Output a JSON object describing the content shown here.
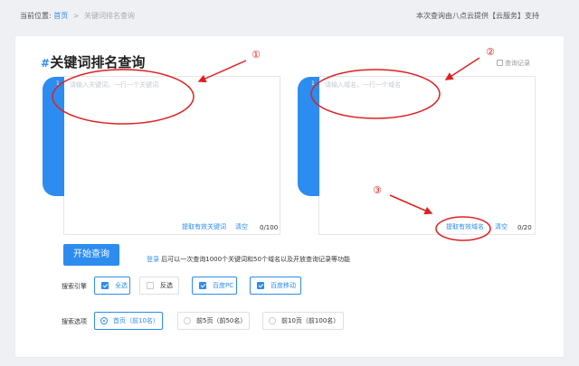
{
  "breadcrumb": {
    "prefix": "当前位置:",
    "home": "首页",
    "separator": ">",
    "current": "关键词排名查询"
  },
  "provider": "本次查询由八点云提供【云服务】支持",
  "page": {
    "title": "关键词排名查询",
    "history": "查询记录"
  },
  "keywords": {
    "line": "1",
    "placeholder": "请输入关键词，一行一个关键词",
    "extract": "提取有效关键词",
    "clear": "清空",
    "count": "0/100"
  },
  "domains": {
    "line": "1",
    "placeholder": "请输入域名，一行一个域名",
    "extract": "提取有效域名",
    "clear": "清空",
    "count": "0/20"
  },
  "annotations": [
    "①",
    "②",
    "③"
  ],
  "start_button": "开始查询",
  "login_tip": {
    "link": "登录",
    "text": "后可以一次查询1000个关键词和50个域名以及开放查询记录等功能"
  },
  "engines": {
    "label": "搜索引擎",
    "options": [
      {
        "label": "全选",
        "checked": true
      },
      {
        "label": "反选",
        "checked": false
      },
      {
        "label": "百度PC",
        "checked": true
      },
      {
        "label": "百度移动",
        "checked": true
      }
    ]
  },
  "search_range": {
    "label": "搜索选项",
    "options": [
      {
        "label": "首页（前10名）",
        "selected": true
      },
      {
        "label": "前5页（前50名）",
        "selected": false
      },
      {
        "label": "前10页（前100名）",
        "selected": false
      }
    ]
  },
  "colors": {
    "accent": "#2d8cf0",
    "annotation": "#e02020",
    "background": "#eef0f4"
  }
}
